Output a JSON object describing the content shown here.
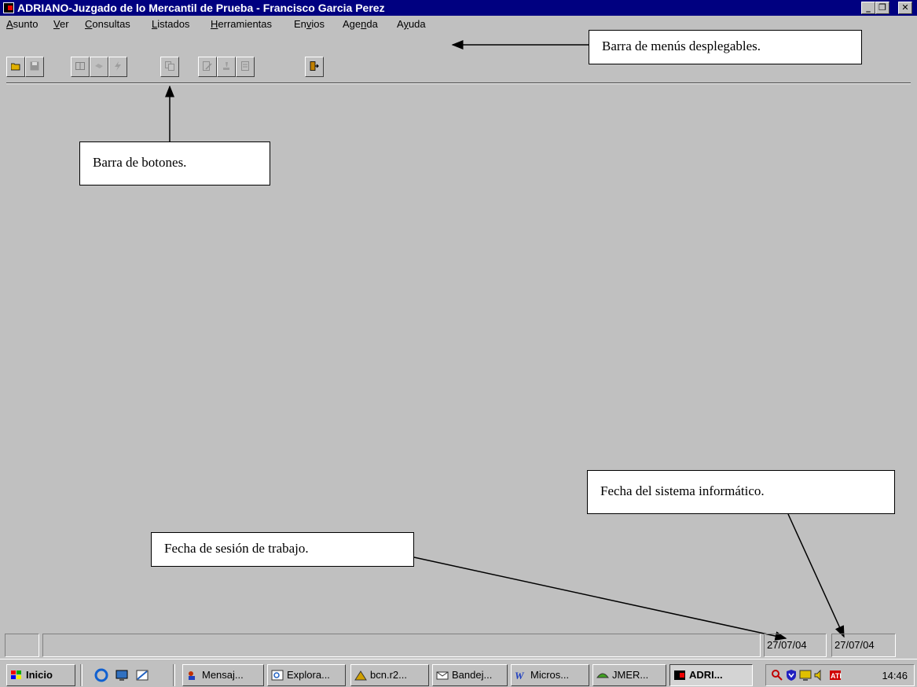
{
  "window": {
    "title": "ADRIANO-Juzgado de lo Mercantil de Prueba - Francisco Garcia Perez",
    "controls": [
      "minimize-icon",
      "maximize-icon",
      "close-icon"
    ]
  },
  "menubar": {
    "items": [
      {
        "label": "Asunto",
        "access_key": "A"
      },
      {
        "label": "Ver",
        "access_key": "V"
      },
      {
        "label": "Consultas",
        "access_key": "C"
      },
      {
        "label": "Listados",
        "access_key": "L"
      },
      {
        "label": "Herramientas",
        "access_key": "H"
      },
      {
        "label": "Envios",
        "access_key": "v"
      },
      {
        "label": "Agenda",
        "access_key": "n"
      },
      {
        "label": "Ayuda",
        "access_key": "y"
      }
    ]
  },
  "toolbar": {
    "buttons": [
      {
        "icon": "open-folder-icon",
        "enabled": true
      },
      {
        "icon": "save-icon",
        "enabled": false
      },
      {
        "icon": "book-icon",
        "enabled": false
      },
      {
        "icon": "handshake-icon",
        "enabled": false
      },
      {
        "icon": "lightning-icon",
        "enabled": false
      },
      {
        "icon": "documents-icon",
        "enabled": false
      },
      {
        "icon": "edit-document-icon",
        "enabled": false
      },
      {
        "icon": "stamp-icon",
        "enabled": false
      },
      {
        "icon": "ledger-icon",
        "enabled": false
      },
      {
        "icon": "exit-door-icon",
        "enabled": true
      }
    ]
  },
  "annotations": {
    "menubar_note": "Barra de menús desplegables.",
    "toolbar_note": "Barra de botones.",
    "session_date_note": "Fecha de sesión de trabajo.",
    "system_date_note": "Fecha del sistema informático."
  },
  "statusbar": {
    "session_date": "27/07/04",
    "system_date": "27/07/04"
  },
  "taskbar": {
    "start_label": "Inicio",
    "quick_launch": [
      "internet-explorer-icon",
      "desktop-icon",
      "outlook-express-icon"
    ],
    "tasks": [
      {
        "label": "Mensaj...",
        "icon": "messenger-icon",
        "active": false
      },
      {
        "label": "Explora...",
        "icon": "explorer-icon",
        "active": false
      },
      {
        "label": "bcn.r2...",
        "icon": "network-icon",
        "active": false
      },
      {
        "label": "Bandej...",
        "icon": "inbox-icon",
        "active": false
      },
      {
        "label": "Micros...",
        "icon": "word-icon",
        "active": false
      },
      {
        "label": "JMER...",
        "icon": "app-icon",
        "active": false
      },
      {
        "label": "ADRI...",
        "icon": "adriano-icon",
        "active": true
      }
    ],
    "tray_icons": [
      "search-icon",
      "shield-icon",
      "monitor-icon",
      "speaker-icon",
      "ati-icon"
    ],
    "clock": "14:46"
  },
  "colors": {
    "titlebar": "#000080",
    "window_bg": "#c0c0c0",
    "callout_bg": "#ffffff"
  }
}
